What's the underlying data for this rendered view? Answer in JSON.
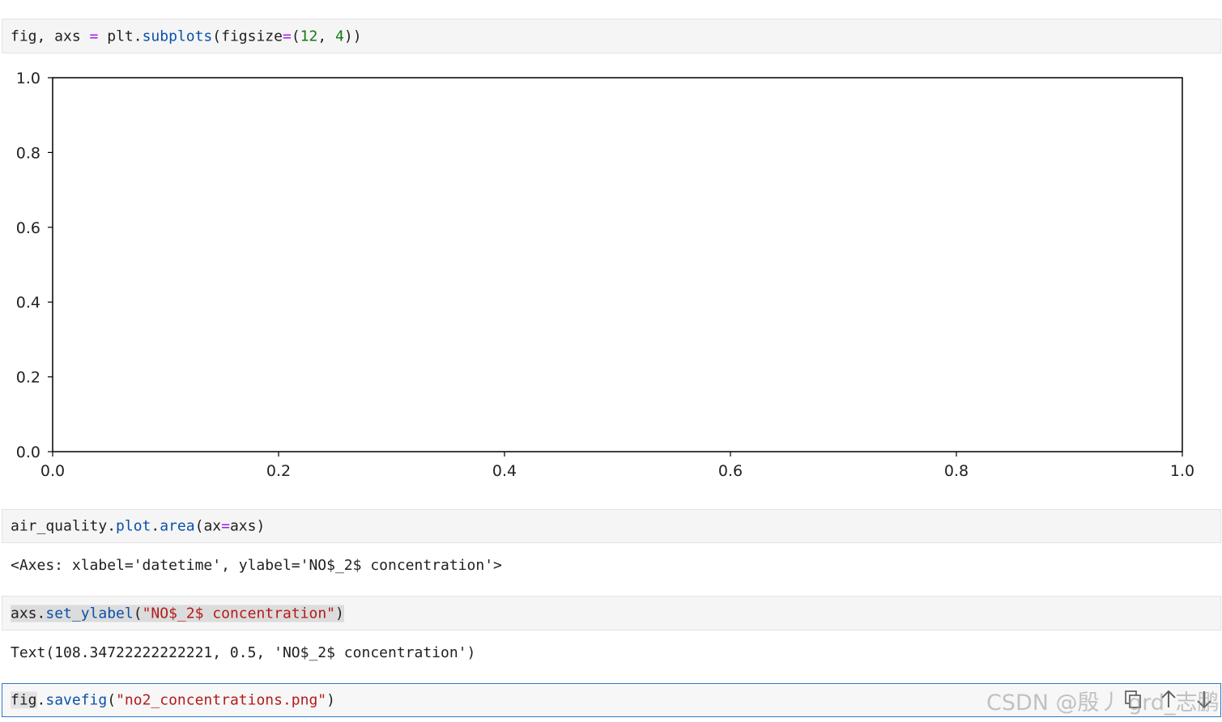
{
  "cells": [
    {
      "tokens": [
        {
          "t": "fig, axs ",
          "c": ""
        },
        {
          "t": "=",
          "c": "t-op"
        },
        {
          "t": " plt.",
          "c": ""
        },
        {
          "t": "subplots",
          "c": "t-fn"
        },
        {
          "t": "(figsize",
          "c": ""
        },
        {
          "t": "=",
          "c": "t-op"
        },
        {
          "t": "(",
          "c": ""
        },
        {
          "t": "12",
          "c": "t-num"
        },
        {
          "t": ", ",
          "c": ""
        },
        {
          "t": "4",
          "c": "t-num"
        },
        {
          "t": "))",
          "c": ""
        }
      ]
    },
    {
      "tokens": [
        {
          "t": "air_quality.",
          "c": ""
        },
        {
          "t": "plot",
          "c": "t-fn"
        },
        {
          "t": ".",
          "c": ""
        },
        {
          "t": "area",
          "c": "t-fn"
        },
        {
          "t": "(ax",
          "c": ""
        },
        {
          "t": "=",
          "c": "t-op"
        },
        {
          "t": "axs)",
          "c": ""
        }
      ],
      "output": "<Axes: xlabel='datetime', ylabel='NO$_2$ concentration'>"
    },
    {
      "tokens": [
        {
          "t": "axs.",
          "c": "hl"
        },
        {
          "t": "set_ylabel",
          "c": "t-fn hl"
        },
        {
          "t": "(",
          "c": "hl"
        },
        {
          "t": "\"NO$_2$ concentration\"",
          "c": "t-str hl"
        },
        {
          "t": ")",
          "c": "hl"
        }
      ],
      "output": "Text(108.34722222222221, 0.5, 'NO$_2$ concentration')"
    },
    {
      "tokens": [
        {
          "t": "fig",
          "c": "hlw"
        },
        {
          "t": ".",
          "c": ""
        },
        {
          "t": "savefig",
          "c": "t-fn"
        },
        {
          "t": "(",
          "c": ""
        },
        {
          "t": "\"no2_concentrations.png\"",
          "c": "t-str"
        },
        {
          "t": ")",
          "c": ""
        }
      ],
      "tools": [
        "copy-icon",
        "move-up-icon",
        "move-down-icon"
      ]
    }
  ],
  "chart_data": {
    "type": "line",
    "title": "",
    "xlabel": "",
    "ylabel": "",
    "xlim": [
      0.0,
      1.0
    ],
    "ylim": [
      0.0,
      1.0
    ],
    "xticks": [
      "0.0",
      "0.2",
      "0.4",
      "0.6",
      "0.8",
      "1.0"
    ],
    "yticks": [
      "0.0",
      "0.2",
      "0.4",
      "0.6",
      "0.8",
      "1.0"
    ],
    "series": [],
    "grid": false
  },
  "watermark": "CSDN @殷丿 grd_志鹏"
}
